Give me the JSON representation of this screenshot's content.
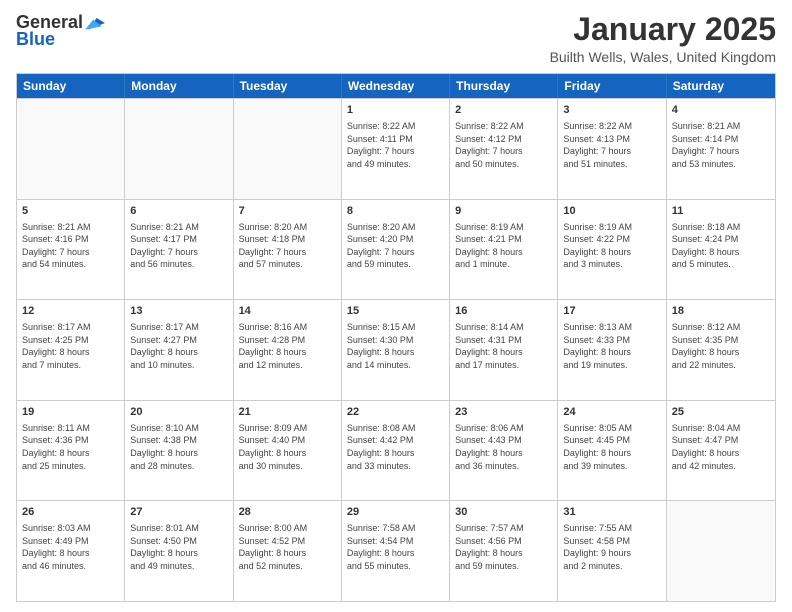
{
  "logo": {
    "general": "General",
    "blue": "Blue"
  },
  "header": {
    "title": "January 2025",
    "subtitle": "Builth Wells, Wales, United Kingdom"
  },
  "days_of_week": [
    "Sunday",
    "Monday",
    "Tuesday",
    "Wednesday",
    "Thursday",
    "Friday",
    "Saturday"
  ],
  "weeks": [
    [
      {
        "day": "",
        "info": ""
      },
      {
        "day": "",
        "info": ""
      },
      {
        "day": "",
        "info": ""
      },
      {
        "day": "1",
        "info": "Sunrise: 8:22 AM\nSunset: 4:11 PM\nDaylight: 7 hours\nand 49 minutes."
      },
      {
        "day": "2",
        "info": "Sunrise: 8:22 AM\nSunset: 4:12 PM\nDaylight: 7 hours\nand 50 minutes."
      },
      {
        "day": "3",
        "info": "Sunrise: 8:22 AM\nSunset: 4:13 PM\nDaylight: 7 hours\nand 51 minutes."
      },
      {
        "day": "4",
        "info": "Sunrise: 8:21 AM\nSunset: 4:14 PM\nDaylight: 7 hours\nand 53 minutes."
      }
    ],
    [
      {
        "day": "5",
        "info": "Sunrise: 8:21 AM\nSunset: 4:16 PM\nDaylight: 7 hours\nand 54 minutes."
      },
      {
        "day": "6",
        "info": "Sunrise: 8:21 AM\nSunset: 4:17 PM\nDaylight: 7 hours\nand 56 minutes."
      },
      {
        "day": "7",
        "info": "Sunrise: 8:20 AM\nSunset: 4:18 PM\nDaylight: 7 hours\nand 57 minutes."
      },
      {
        "day": "8",
        "info": "Sunrise: 8:20 AM\nSunset: 4:20 PM\nDaylight: 7 hours\nand 59 minutes."
      },
      {
        "day": "9",
        "info": "Sunrise: 8:19 AM\nSunset: 4:21 PM\nDaylight: 8 hours\nand 1 minute."
      },
      {
        "day": "10",
        "info": "Sunrise: 8:19 AM\nSunset: 4:22 PM\nDaylight: 8 hours\nand 3 minutes."
      },
      {
        "day": "11",
        "info": "Sunrise: 8:18 AM\nSunset: 4:24 PM\nDaylight: 8 hours\nand 5 minutes."
      }
    ],
    [
      {
        "day": "12",
        "info": "Sunrise: 8:17 AM\nSunset: 4:25 PM\nDaylight: 8 hours\nand 7 minutes."
      },
      {
        "day": "13",
        "info": "Sunrise: 8:17 AM\nSunset: 4:27 PM\nDaylight: 8 hours\nand 10 minutes."
      },
      {
        "day": "14",
        "info": "Sunrise: 8:16 AM\nSunset: 4:28 PM\nDaylight: 8 hours\nand 12 minutes."
      },
      {
        "day": "15",
        "info": "Sunrise: 8:15 AM\nSunset: 4:30 PM\nDaylight: 8 hours\nand 14 minutes."
      },
      {
        "day": "16",
        "info": "Sunrise: 8:14 AM\nSunset: 4:31 PM\nDaylight: 8 hours\nand 17 minutes."
      },
      {
        "day": "17",
        "info": "Sunrise: 8:13 AM\nSunset: 4:33 PM\nDaylight: 8 hours\nand 19 minutes."
      },
      {
        "day": "18",
        "info": "Sunrise: 8:12 AM\nSunset: 4:35 PM\nDaylight: 8 hours\nand 22 minutes."
      }
    ],
    [
      {
        "day": "19",
        "info": "Sunrise: 8:11 AM\nSunset: 4:36 PM\nDaylight: 8 hours\nand 25 minutes."
      },
      {
        "day": "20",
        "info": "Sunrise: 8:10 AM\nSunset: 4:38 PM\nDaylight: 8 hours\nand 28 minutes."
      },
      {
        "day": "21",
        "info": "Sunrise: 8:09 AM\nSunset: 4:40 PM\nDaylight: 8 hours\nand 30 minutes."
      },
      {
        "day": "22",
        "info": "Sunrise: 8:08 AM\nSunset: 4:42 PM\nDaylight: 8 hours\nand 33 minutes."
      },
      {
        "day": "23",
        "info": "Sunrise: 8:06 AM\nSunset: 4:43 PM\nDaylight: 8 hours\nand 36 minutes."
      },
      {
        "day": "24",
        "info": "Sunrise: 8:05 AM\nSunset: 4:45 PM\nDaylight: 8 hours\nand 39 minutes."
      },
      {
        "day": "25",
        "info": "Sunrise: 8:04 AM\nSunset: 4:47 PM\nDaylight: 8 hours\nand 42 minutes."
      }
    ],
    [
      {
        "day": "26",
        "info": "Sunrise: 8:03 AM\nSunset: 4:49 PM\nDaylight: 8 hours\nand 46 minutes."
      },
      {
        "day": "27",
        "info": "Sunrise: 8:01 AM\nSunset: 4:50 PM\nDaylight: 8 hours\nand 49 minutes."
      },
      {
        "day": "28",
        "info": "Sunrise: 8:00 AM\nSunset: 4:52 PM\nDaylight: 8 hours\nand 52 minutes."
      },
      {
        "day": "29",
        "info": "Sunrise: 7:58 AM\nSunset: 4:54 PM\nDaylight: 8 hours\nand 55 minutes."
      },
      {
        "day": "30",
        "info": "Sunrise: 7:57 AM\nSunset: 4:56 PM\nDaylight: 8 hours\nand 59 minutes."
      },
      {
        "day": "31",
        "info": "Sunrise: 7:55 AM\nSunset: 4:58 PM\nDaylight: 9 hours\nand 2 minutes."
      },
      {
        "day": "",
        "info": ""
      }
    ]
  ]
}
